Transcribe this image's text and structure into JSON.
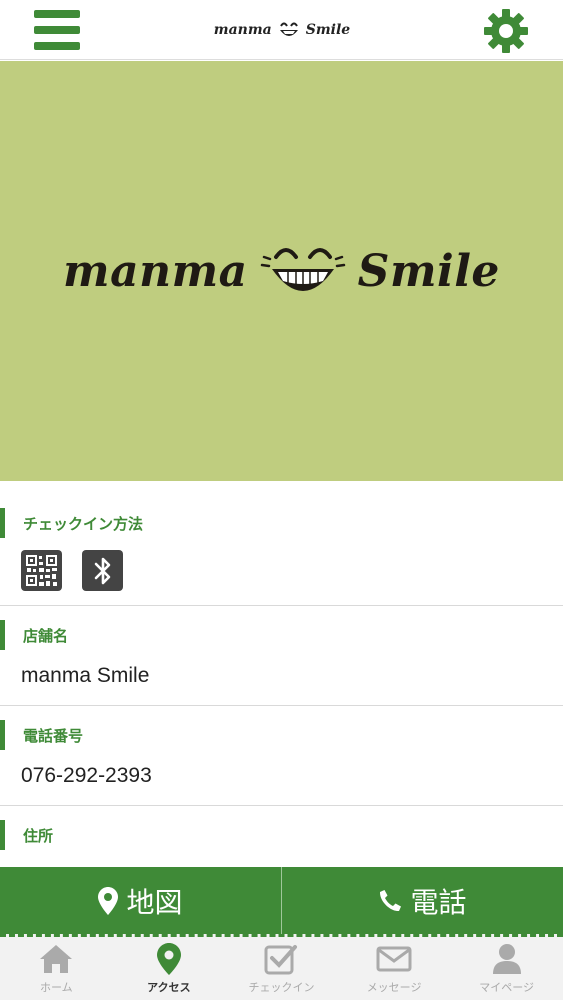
{
  "header": {
    "menu_icon": "hamburger-menu-icon",
    "logo_left": "manma",
    "logo_right": "Smile",
    "settings_icon": "gear-icon"
  },
  "hero": {
    "logo_left": "manma",
    "logo_right": "Smile"
  },
  "sections": {
    "checkin": {
      "label": "チェックイン方法",
      "icons": [
        "qr-code-icon",
        "bluetooth-icon"
      ]
    },
    "shop_name": {
      "label": "店舗名",
      "value": "manma Smile"
    },
    "phone": {
      "label": "電話番号",
      "value": "076-292-2393"
    },
    "address": {
      "label": "住所"
    }
  },
  "actions": {
    "map_label": "地図",
    "phone_label": "電話"
  },
  "tabs": [
    {
      "label": "ホーム",
      "icon": "home-icon",
      "active": false
    },
    {
      "label": "アクセス",
      "icon": "map-pin-icon",
      "active": true
    },
    {
      "label": "チェックイン",
      "icon": "checkbox-icon",
      "active": false
    },
    {
      "label": "メッセージ",
      "icon": "envelope-icon",
      "active": false
    },
    {
      "label": "マイページ",
      "icon": "user-icon",
      "active": false
    }
  ],
  "colors": {
    "brand_green": "#3f8a37",
    "hero_bg": "#bfcd7f",
    "tab_inactive": "#aaaaaa",
    "icon_dark": "#444444"
  }
}
